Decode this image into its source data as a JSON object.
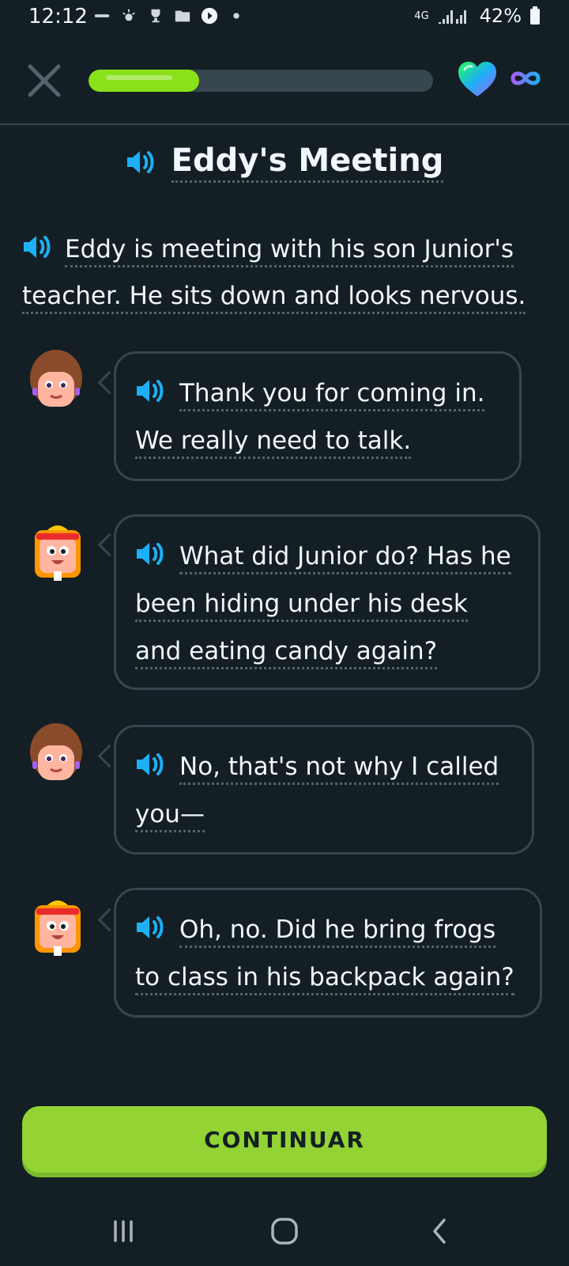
{
  "status_bar": {
    "time": "12:12",
    "network": "4G",
    "battery": "42%"
  },
  "lesson": {
    "progress_fraction": 0.32,
    "title": "Eddy's Meeting",
    "narration": "Eddy is meeting with his son Junior's teacher. He sits down and looks nervous."
  },
  "dialogue": [
    {
      "speaker": "teacher",
      "text": "Thank you for coming in. We really need to talk."
    },
    {
      "speaker": "eddy",
      "text": "What did Junior do? Has he been hiding under his desk and eating candy again?"
    },
    {
      "speaker": "teacher",
      "text": "No, that's not why I called you—"
    },
    {
      "speaker": "eddy",
      "text": "Oh, no. Did he bring frogs to class in his backpack again?"
    }
  ],
  "continue_label": "CONTINUAR",
  "colors": {
    "background": "#131f24",
    "accent_green": "#93d333",
    "speaker_blue": "#1cb0f6",
    "border": "#37464f"
  }
}
